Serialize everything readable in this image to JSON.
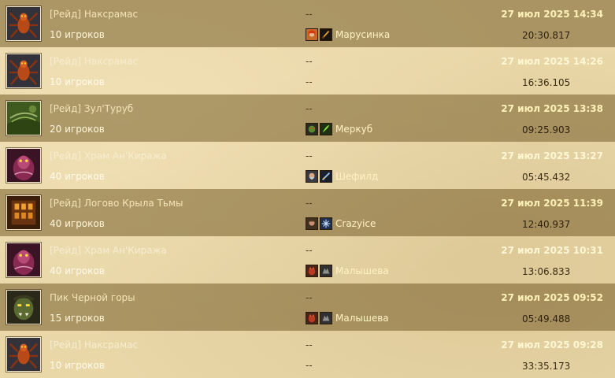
{
  "rows": [
    {
      "name": "[Рейд] Наксрамас",
      "players": "10 игроков",
      "dash": "--",
      "killer": "Марусинка",
      "killer_icons": [
        "female-human-portrait-icon",
        "dagger-class-icon"
      ],
      "date": "27 июл 2025 14:34",
      "time": "20:30.817",
      "thumb": "naxxramas-spider-icon"
    },
    {
      "name": "[Рейд] Наксрамас",
      "players": "10 игроков",
      "dash": "--",
      "dash2": "--",
      "date": "27 июл 2025 14:26",
      "time": "16:36.105",
      "thumb": "naxxramas-spider-icon"
    },
    {
      "name": "[Рейд] Зул'Туруб",
      "players": "20 игроков",
      "dash": "--",
      "killer": "Меркуб",
      "killer_icons": [
        "orc-portrait-icon",
        "nature-class-icon"
      ],
      "date": "27 июл 2025 13:38",
      "time": "09:25.903",
      "thumb": "zulgurub-jungle-icon"
    },
    {
      "name": "[Рейд] Храм Ан'Киража",
      "players": "40 игроков",
      "dash": "--",
      "killer": "Шефилд",
      "killer_icons": [
        "dwarf-portrait-icon",
        "sword-class-icon"
      ],
      "date": "27 июл 2025 13:27",
      "time": "05:45.432",
      "thumb": "ahnqiraj-creature-icon"
    },
    {
      "name": "[Рейд] Логово Крыла Тьмы",
      "players": "40 игроков",
      "dash": "--",
      "killer": "Crazyice",
      "killer_icons": [
        "human-portrait-icon",
        "frost-class-icon"
      ],
      "date": "27 июл 2025 11:39",
      "time": "12:40.937",
      "thumb": "blackwing-lair-icon"
    },
    {
      "name": "[Рейд] Храм Ан'Киража",
      "players": "40 игроков",
      "dash": "--",
      "killer": "Малышева",
      "killer_icons": [
        "beast-portrait-icon",
        "wolf-class-icon"
      ],
      "date": "27 июл 2025 10:31",
      "time": "13:06.833",
      "thumb": "ahnqiraj-creature-icon"
    },
    {
      "name": "Пик Черной горы",
      "players": "15 игроков",
      "dash": "--",
      "killer": "Малышева",
      "killer_icons": [
        "beast-portrait-icon",
        "wolf-class-icon"
      ],
      "date": "27 июл 2025 09:52",
      "time": "05:49.488",
      "thumb": "blackrock-orc-icon"
    },
    {
      "name": "[Рейд] Наксрамас",
      "players": "10 игроков",
      "dash": "--",
      "dash2": "--",
      "date": "27 июл 2025 09:28",
      "time": "33:35.173",
      "thumb": "naxxramas-spider-icon"
    }
  ],
  "colors": {
    "row_dark": "#78602f",
    "name_text": "#f3e4b8",
    "date_text": "#fff1b8",
    "time_text": "#3b2d14"
  }
}
